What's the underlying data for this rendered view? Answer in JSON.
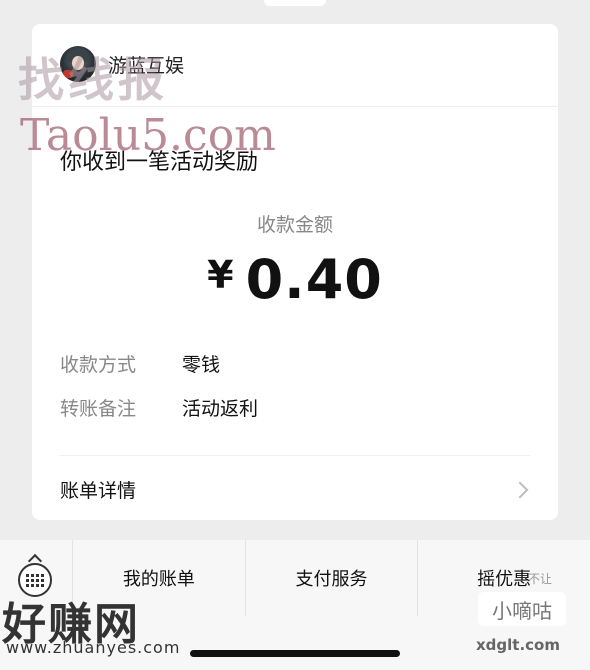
{
  "merchant": {
    "name": "游蓝互娱",
    "avatar_icon": "profile-avatar"
  },
  "notice": {
    "headline": "你收到一笔活动奖励"
  },
  "amount": {
    "label": "收款金额",
    "currency": "¥",
    "value": "0.40"
  },
  "rows": [
    {
      "key": "收款方式",
      "value": "零钱"
    },
    {
      "key": "转账备注",
      "value": "活动返利"
    }
  ],
  "details": {
    "label": "账单详情",
    "icon": "chevron-right-icon"
  },
  "bottom_menu": {
    "keyboard_icon": "keyboard-icon",
    "items": [
      "我的账单",
      "支付服务",
      "摇优惠"
    ]
  },
  "watermarks": {
    "top_cn": "找线报",
    "top_en": "Taolu5.com",
    "bottom_left_cn": "好赚网",
    "bottom_left_url": "www.zhuanyes.com",
    "bottom_right_cn": "小嘀咕",
    "bottom_right_url": "xdglt.com",
    "bottom_right_small": "不让"
  }
}
